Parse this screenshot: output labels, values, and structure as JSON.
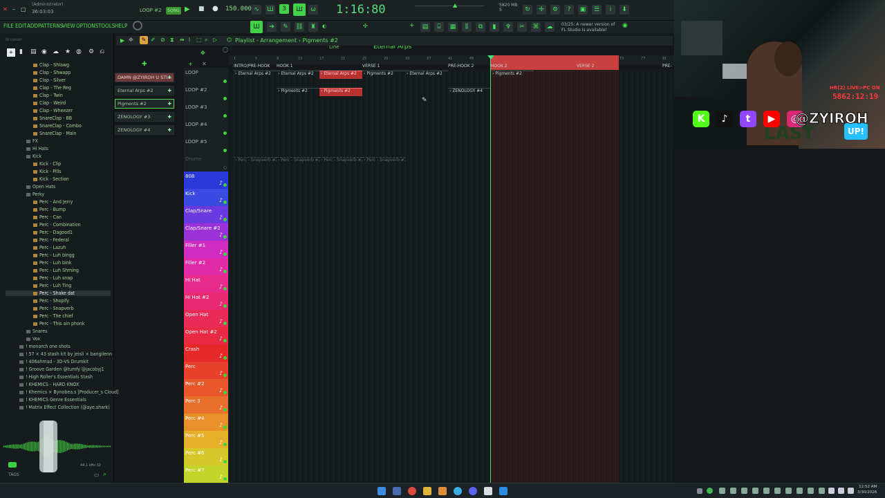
{
  "topbar": {
    "user_label": "(Administrator)",
    "user_time": "36:03:03",
    "pattern_selector": "LOOP #2",
    "song_label": "SONG",
    "tempo": "150.000",
    "timecode": "1:16:80",
    "memory": "5820 MB",
    "memory_sub": "5"
  },
  "menu": [
    "FILE",
    "EDIT",
    "ADD",
    "PATTERNS",
    "VIEW",
    "OPTIONS",
    "TOOLS",
    "HELP"
  ],
  "toolbar2": {
    "line_mode": "Line",
    "pattern_name": "Eternal Arps"
  },
  "news": {
    "line1": "03/25: A newer version of",
    "line2": "FL Studio is available!"
  },
  "browser": {
    "header": "Browser",
    "items": [
      {
        "label": "Clap - Shlawg",
        "indent": 2,
        "type": "file"
      },
      {
        "label": "Clap - Shwapp",
        "indent": 2,
        "type": "file"
      },
      {
        "label": "Clap - Silver",
        "indent": 2,
        "type": "file"
      },
      {
        "label": "Clap - The Reg",
        "indent": 2,
        "type": "file"
      },
      {
        "label": "Clap - Twin",
        "indent": 2,
        "type": "file"
      },
      {
        "label": "Clap - Weird",
        "indent": 2,
        "type": "file"
      },
      {
        "label": "Clap - Wheezer",
        "indent": 2,
        "type": "file"
      },
      {
        "label": "SnareClap - BB",
        "indent": 2,
        "type": "file"
      },
      {
        "label": "SnareClap - Combo",
        "indent": 2,
        "type": "file"
      },
      {
        "label": "SnareClap - Main",
        "indent": 2,
        "type": "file"
      },
      {
        "label": "FX",
        "indent": 1,
        "type": "folder"
      },
      {
        "label": "Hi Hats",
        "indent": 1,
        "type": "folder"
      },
      {
        "label": "Kick",
        "indent": 1,
        "type": "folder"
      },
      {
        "label": "Kick - Clip",
        "indent": 2,
        "type": "file"
      },
      {
        "label": "Kick - Pills",
        "indent": 2,
        "type": "file"
      },
      {
        "label": "Kick - Section",
        "indent": 2,
        "type": "file"
      },
      {
        "label": "Open Hats",
        "indent": 1,
        "type": "folder"
      },
      {
        "label": "Perky",
        "indent": 1,
        "type": "folder"
      },
      {
        "label": "Perc - And Jerry",
        "indent": 2,
        "type": "file"
      },
      {
        "label": "Perc - Bump",
        "indent": 2,
        "type": "file"
      },
      {
        "label": "Perc - Can",
        "indent": 2,
        "type": "file"
      },
      {
        "label": "Perc - Combination",
        "indent": 2,
        "type": "file"
      },
      {
        "label": "Perc - Dagood1",
        "indent": 2,
        "type": "file"
      },
      {
        "label": "Perc - Federal",
        "indent": 2,
        "type": "file"
      },
      {
        "label": "Perc - Lazuh",
        "indent": 2,
        "type": "file"
      },
      {
        "label": "Perc - Luh bingg",
        "indent": 2,
        "type": "file"
      },
      {
        "label": "Perc - Luh bink",
        "indent": 2,
        "type": "file"
      },
      {
        "label": "Perc - Luh Shming",
        "indent": 2,
        "type": "file"
      },
      {
        "label": "Perc - Luh snap",
        "indent": 2,
        "type": "file"
      },
      {
        "label": "Perc - Luh Ting",
        "indent": 2,
        "type": "file"
      },
      {
        "label": "Perc - Shake dat",
        "indent": 2,
        "type": "file",
        "selected": true
      },
      {
        "label": "Perc - Shopify",
        "indent": 2,
        "type": "file"
      },
      {
        "label": "Perc - Snapverb",
        "indent": 2,
        "type": "file"
      },
      {
        "label": "Perc - The chief",
        "indent": 2,
        "type": "file"
      },
      {
        "label": "Perc - This ain phonk",
        "indent": 2,
        "type": "file"
      },
      {
        "label": "Snares",
        "indent": 1,
        "type": "folder"
      },
      {
        "label": "Vox",
        "indent": 1,
        "type": "folder"
      },
      {
        "label": "! monarch one shots",
        "indent": 0,
        "type": "folder"
      },
      {
        "label": "! 57 × 43 stash kit by jeisli × bangilenn",
        "indent": 0,
        "type": "folder"
      },
      {
        "label": "! 406ahmad - 3D-VS Drumkit",
        "indent": 0,
        "type": "folder"
      },
      {
        "label": "! Groove Garden @tumfy @jacobyj1",
        "indent": 0,
        "type": "folder"
      },
      {
        "label": "! High Roller's Essentials Stash",
        "indent": 0,
        "type": "folder"
      },
      {
        "label": "! KHEMICS - HARD KNOX",
        "indent": 0,
        "type": "folder"
      },
      {
        "label": "! Khemics × Bynobea.s [Producer_s Cloud]",
        "indent": 0,
        "type": "folder"
      },
      {
        "label": "! KHEMICS Genre Essentials",
        "indent": 0,
        "type": "folder"
      },
      {
        "label": "! Matrix Effect Collection (@aye.shark)",
        "indent": 0,
        "type": "folder"
      }
    ],
    "tags_label": "TAGS",
    "sample_info": "44.1 kHz 32"
  },
  "playlist": {
    "title": "Playlist - Arrangement › Pigments #2",
    "patterns": [
      {
        "label": "DAMN @ZYIROH U STI...",
        "style": "sel"
      },
      {
        "label": "Eternal Arps #2",
        "style": ""
      },
      {
        "label": "Pigments #2",
        "style": "hl"
      },
      {
        "label": "ZENOLOGY #3",
        "style": ""
      },
      {
        "label": "ZENOLOGY #4",
        "style": ""
      }
    ],
    "ticks": [
      "1",
      "5",
      "9",
      "13",
      "17",
      "21",
      "25",
      "29",
      "33",
      "37",
      "41",
      "45",
      "49",
      "53",
      "57",
      "61",
      "65",
      "69",
      "73",
      "77",
      "81"
    ],
    "markers": [
      {
        "label": "INTRO/PRE-HOOK",
        "bar": 1
      },
      {
        "label": "HOOK 1",
        "bar": 9
      },
      {
        "label": "VERSE 1",
        "bar": 25
      },
      {
        "label": "PRE-HOOK 2",
        "bar": 41
      },
      {
        "label": "HOOK 2",
        "bar": 49
      },
      {
        "label": "VERSE 2",
        "bar": 65
      },
      {
        "label": "PRE-",
        "bar": 81
      }
    ],
    "tracks": [
      {
        "label": "LOOP",
        "color": "loop"
      },
      {
        "label": "LOOP #2",
        "color": "loop"
      },
      {
        "label": "LOOP #3",
        "color": "loop"
      },
      {
        "label": "LOOP #4",
        "color": "loop"
      },
      {
        "label": "LOOP #5",
        "color": "loop"
      },
      {
        "label": "Drums",
        "color": "drums"
      },
      {
        "label": "808",
        "color": "#2a3ad8"
      },
      {
        "label": "Kick",
        "color": "#3a4ae0"
      },
      {
        "label": "Clap/Snare",
        "color": "#6a3ae0"
      },
      {
        "label": "Clap/Snare #2",
        "color": "#9a32d8"
      },
      {
        "label": "Filler #1",
        "color": "#d02cc0"
      },
      {
        "label": "Filler #2",
        "color": "#e02aa6"
      },
      {
        "label": "Hi Hat",
        "color": "#e82a8a"
      },
      {
        "label": "Hi Hat #2",
        "color": "#ea2a70"
      },
      {
        "label": "Open Hat",
        "color": "#ea2a58"
      },
      {
        "label": "Open Hat #2",
        "color": "#e82a42"
      },
      {
        "label": "Crash",
        "color": "#e62a2a"
      },
      {
        "label": "Perc",
        "color": "#e8402a"
      },
      {
        "label": "Perc #2",
        "color": "#e8582a"
      },
      {
        "label": "Perc 3",
        "color": "#e8702a"
      },
      {
        "label": "Perc #4",
        "color": "#e8902a"
      },
      {
        "label": "Perc #5",
        "color": "#e6b02a"
      },
      {
        "label": "Perc #6",
        "color": "#d4c82a"
      },
      {
        "label": "Perc #7",
        "color": "#c4d42a"
      }
    ],
    "clips": [
      {
        "label": "Eternal Arps #2",
        "row": 0,
        "start": 1,
        "len": 8,
        "style": ""
      },
      {
        "label": "Eternal Arps #2",
        "row": 0,
        "start": 9,
        "len": 8,
        "style": ""
      },
      {
        "label": "Eternal Arps #2",
        "row": 0,
        "start": 17,
        "len": 8,
        "style": "red"
      },
      {
        "label": "Pigments #2",
        "row": 0,
        "start": 25,
        "len": 8,
        "style": ""
      },
      {
        "label": "Eternal Arps #2",
        "row": 0,
        "start": 33,
        "len": 8,
        "style": ""
      },
      {
        "label": "Pigments #2",
        "row": 0,
        "start": 49,
        "len": 8,
        "style": ""
      },
      {
        "label": "Pigments #2",
        "row": 1,
        "start": 9,
        "len": 8,
        "style": ""
      },
      {
        "label": "Pigments #2",
        "row": 1,
        "start": 17,
        "len": 8,
        "style": "red"
      },
      {
        "label": "ZENOLOGY #4",
        "row": 1,
        "start": 41,
        "len": 8,
        "style": ""
      },
      {
        "label": "Perc - Snapverb #2",
        "row": 5,
        "start": 1,
        "len": 8,
        "style": "faint"
      },
      {
        "label": "Perc - Snapverb #2",
        "row": 5,
        "start": 9,
        "len": 8,
        "style": "faint"
      },
      {
        "label": "Perc - Snapverb #2",
        "row": 5,
        "start": 17,
        "len": 8,
        "style": "faint"
      },
      {
        "label": "Perc - Snapverb #2",
        "row": 5,
        "start": 25,
        "len": 8,
        "style": "faint"
      }
    ]
  },
  "stream": {
    "live_label": "HR(2) LIVE>PC ON",
    "live_time": "5862:12:19",
    "handle": "@ZYIROH",
    "socials": [
      {
        "label": "K",
        "color": "#53fc18"
      },
      {
        "label": "♪",
        "color": "#111111"
      },
      {
        "label": "t",
        "color": "#9146ff"
      },
      {
        "label": "▶",
        "color": "#ff0000"
      },
      {
        "label": "◎",
        "color": "#d62976"
      }
    ]
  },
  "taskbar": {
    "time": "12:52 AM",
    "date": "3/30/2026"
  }
}
